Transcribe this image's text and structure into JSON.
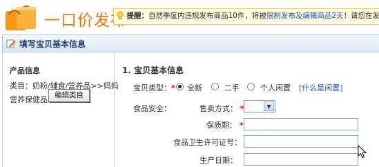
{
  "header": {
    "title": "一口价发布",
    "notice": {
      "label": "提醒：",
      "text_before": "自然季度内违规发布商品10件，将被",
      "link": "限制发布及编辑商品2天",
      "text_after": "！请您在发布前"
    }
  },
  "section": {
    "title": "填写宝贝基本信息"
  },
  "product_info": {
    "title": "产品信息",
    "category_line1": "类目：奶粉/辅食/营养品>>妈妈",
    "category_line2": "营养保健品",
    "edit_button": "编辑类目"
  },
  "form": {
    "title": "1. 宝贝基本信息",
    "item_type_label": "宝贝类型：",
    "item_type_options": [
      "全新",
      "二手",
      "个人闲置"
    ],
    "item_type_selected": "全新",
    "item_type_help": "[什么是闲置]",
    "food_safety_label": "食品安全：",
    "sale_method_label": "售卖方式：",
    "sale_method_value": "",
    "shelf_life_label": "保质期：",
    "shelf_life_value": "",
    "license_label": "食品卫生许可证号：",
    "license_value": "",
    "production_date_label": "生产日期：",
    "production_date_value": ""
  },
  "colors": {
    "brand_orange": "#f07a00",
    "link_blue": "#1b59b8",
    "required_red": "#e00000",
    "notice_bg": "#fffbdc"
  },
  "icons": [
    "shopping-bag-icon",
    "lightbulb-icon",
    "pencil-icon",
    "chevron-down-icon",
    "mouse-cursor-icon"
  ]
}
